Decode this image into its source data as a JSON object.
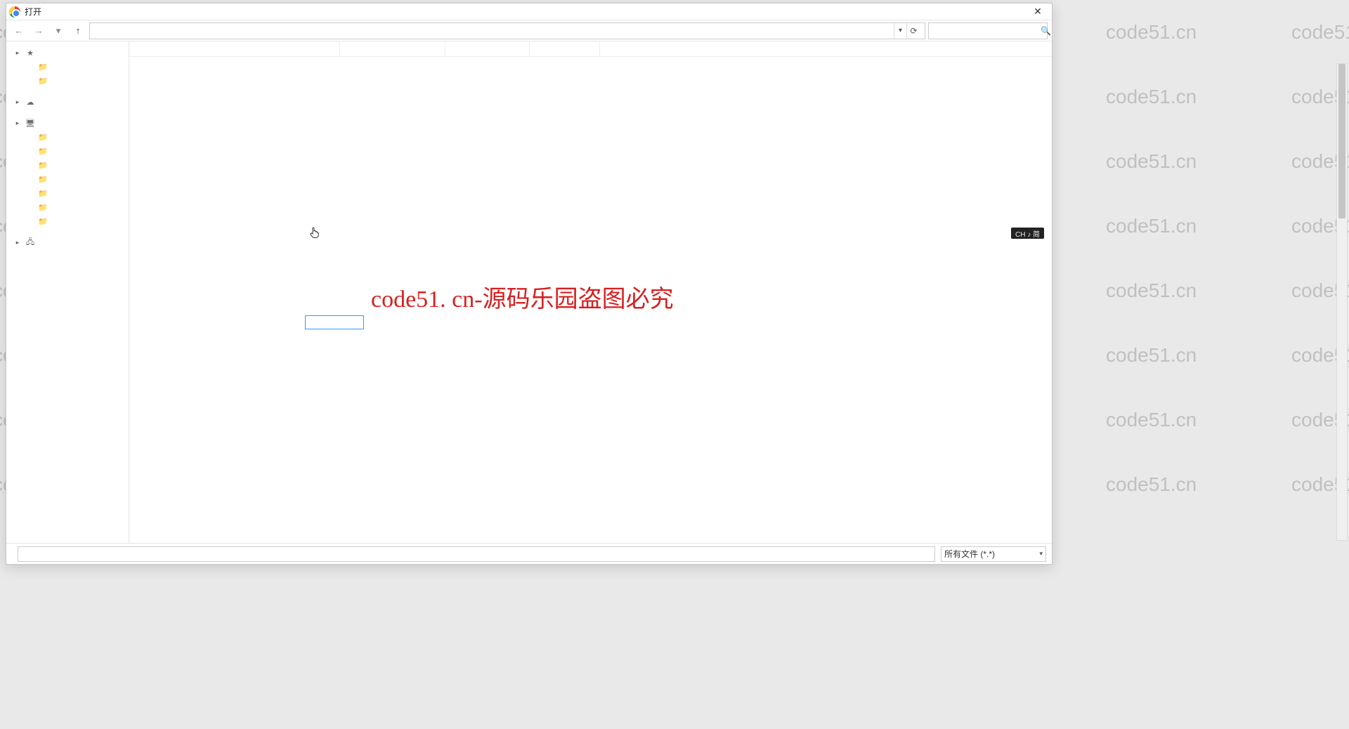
{
  "watermark_text": "code51.cn",
  "center_text": "code51. cn-源码乐园盗图必究",
  "ime_badge": "CH ♪ 简",
  "dialog": {
    "title": "打开",
    "breadcrumb": "",
    "search_placeholder": "",
    "columns": {
      "name": "",
      "date": "",
      "type": "",
      "size": ""
    },
    "filename_label": "",
    "filename_value": "",
    "filter_selected": "所有文件 (*.*)",
    "sidebar": [
      {
        "kind": "item",
        "label": "",
        "icon": "star"
      },
      {
        "kind": "sub",
        "label": ""
      },
      {
        "kind": "sub",
        "label": ""
      },
      {
        "kind": "sep"
      },
      {
        "kind": "item",
        "label": "",
        "icon": "onedrive"
      },
      {
        "kind": "sep"
      },
      {
        "kind": "item",
        "label": "",
        "icon": "pc"
      },
      {
        "kind": "sub",
        "label": ""
      },
      {
        "kind": "sub",
        "label": ""
      },
      {
        "kind": "sub",
        "label": ""
      },
      {
        "kind": "sub",
        "label": ""
      },
      {
        "kind": "sub",
        "label": ""
      },
      {
        "kind": "sub",
        "label": ""
      },
      {
        "kind": "sub",
        "label": ""
      },
      {
        "kind": "sep"
      },
      {
        "kind": "item",
        "label": "",
        "icon": "net"
      }
    ]
  }
}
